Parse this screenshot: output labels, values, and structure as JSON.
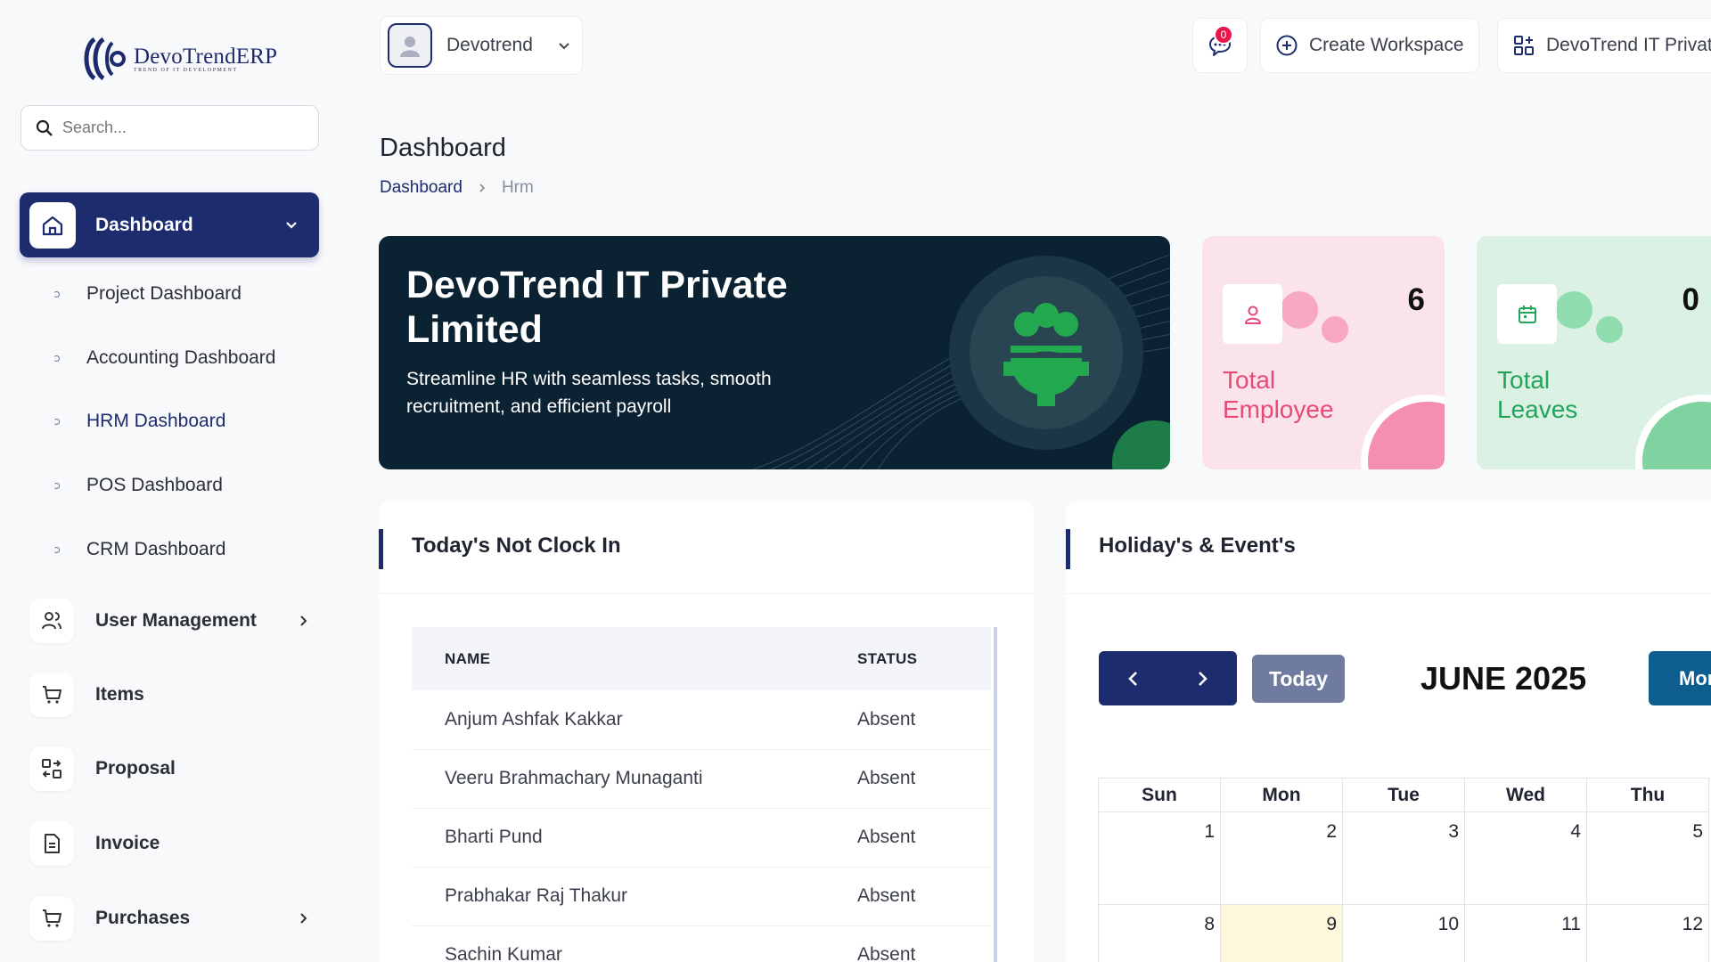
{
  "brand": {
    "name": "DevoTrendERP",
    "tagline": "TREND OF IT DEVELOPMENT"
  },
  "search": {
    "placeholder": "Search..."
  },
  "sidebar": {
    "active": {
      "label": "Dashboard"
    },
    "sub_items": [
      {
        "label": "Project Dashboard"
      },
      {
        "label": "Accounting Dashboard"
      },
      {
        "label": "HRM Dashboard"
      },
      {
        "label": "POS Dashboard"
      },
      {
        "label": "CRM Dashboard"
      }
    ],
    "items": [
      {
        "label": "User Management",
        "icon": "users-icon"
      },
      {
        "label": "Items",
        "icon": "cart-icon"
      },
      {
        "label": "Proposal",
        "icon": "proposal-icon"
      },
      {
        "label": "Invoice",
        "icon": "invoice-icon"
      },
      {
        "label": "Purchases",
        "icon": "cart-icon"
      }
    ]
  },
  "topbar": {
    "workspace": "Devotrend",
    "messages_count": "0",
    "create_workspace": "Create Workspace",
    "company": "DevoTrend IT Private Limited"
  },
  "page": {
    "title": "Dashboard",
    "breadcrumb": [
      "Dashboard",
      "Hrm"
    ]
  },
  "banner": {
    "title": "DevoTrend IT Private Limited",
    "subtitle": "Streamline HR with seamless tasks, smooth recruitment, and efficient payroll"
  },
  "stats": [
    {
      "label": "Total Employee",
      "value": "6",
      "color": "#e8497a",
      "bg": "#fbe3ea",
      "accent": "#f48fb1"
    },
    {
      "label": "Total Leaves",
      "value": "0",
      "color": "#22a45a",
      "bg": "#dbf1e4",
      "accent": "#7ed3a0"
    }
  ],
  "not_clock_in": {
    "title": "Today's Not Clock In",
    "columns": [
      "NAME",
      "STATUS"
    ],
    "rows": [
      {
        "name": "Anjum Ashfak Kakkar",
        "status": "Absent"
      },
      {
        "name": "Veeru Brahmachary Munaganti",
        "status": "Absent"
      },
      {
        "name": "Bharti Pund",
        "status": "Absent"
      },
      {
        "name": "Prabhakar Raj Thakur",
        "status": "Absent"
      },
      {
        "name": "Sachin Kumar",
        "status": "Absent"
      }
    ]
  },
  "events": {
    "title": "Holiday's & Event's",
    "today_label": "Today",
    "month_title": "JUNE 2025",
    "view_label": "Month",
    "weekdays": [
      "Sun",
      "Mon",
      "Tue",
      "Wed",
      "Thu"
    ],
    "weeks": [
      [
        "1",
        "2",
        "3",
        "4",
        "5"
      ],
      [
        "8",
        "9",
        "10",
        "11",
        "12"
      ]
    ],
    "today": "9"
  },
  "colors": {
    "primary": "#1d2c6e",
    "banner_bg": "#0b2233",
    "highlight": "#fdf7dc"
  }
}
